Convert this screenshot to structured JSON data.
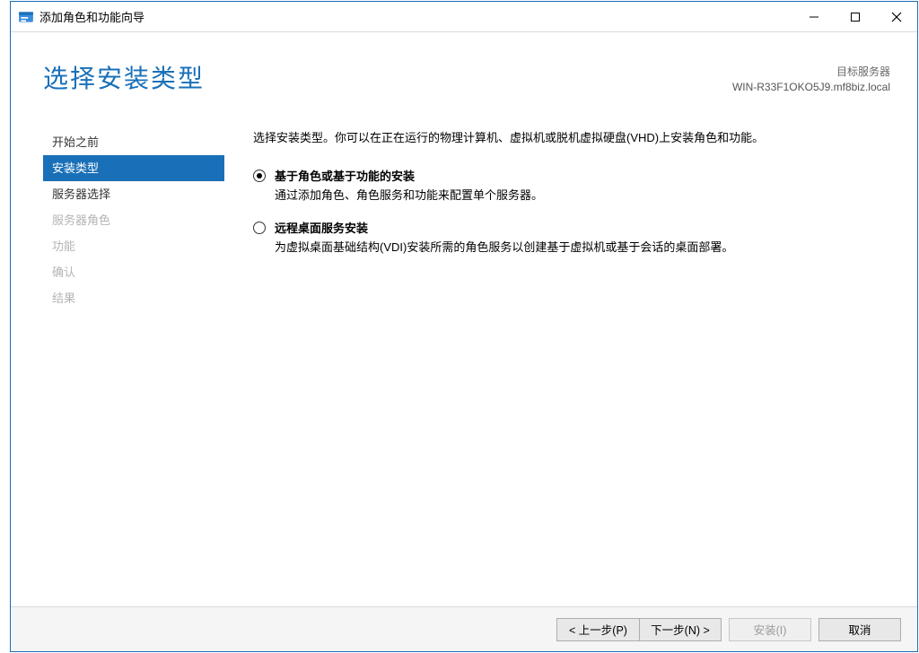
{
  "window": {
    "title": "添加角色和功能向导"
  },
  "header": {
    "page_title": "选择安装类型",
    "target_label": "目标服务器",
    "target_value": "WIN-R33F1OKO5J9.mf8biz.local"
  },
  "sidebar": {
    "items": [
      {
        "label": "开始之前",
        "state": "normal"
      },
      {
        "label": "安装类型",
        "state": "selected"
      },
      {
        "label": "服务器选择",
        "state": "normal"
      },
      {
        "label": "服务器角色",
        "state": "disabled"
      },
      {
        "label": "功能",
        "state": "disabled"
      },
      {
        "label": "确认",
        "state": "disabled"
      },
      {
        "label": "结果",
        "state": "disabled"
      }
    ]
  },
  "content": {
    "instruction": "选择安装类型。你可以在正在运行的物理计算机、虚拟机或脱机虚拟硬盘(VHD)上安装角色和功能。",
    "options": [
      {
        "title": "基于角色或基于功能的安装",
        "desc": "通过添加角色、角色服务和功能来配置单个服务器。",
        "checked": true
      },
      {
        "title": "远程桌面服务安装",
        "desc": "为虚拟桌面基础结构(VDI)安装所需的角色服务以创建基于虚拟机或基于会话的桌面部署。",
        "checked": false
      }
    ]
  },
  "footer": {
    "prev": "< 上一步(P)",
    "next": "下一步(N) >",
    "install": "安装(I)",
    "cancel": "取消"
  }
}
